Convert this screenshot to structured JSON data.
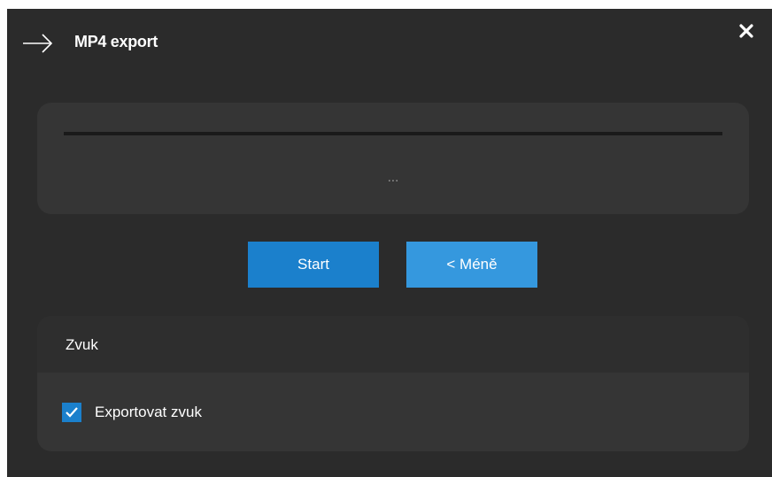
{
  "header": {
    "title": "MP4 export",
    "back_icon": "arrow-right-icon",
    "close_icon": "close-icon"
  },
  "progress": {
    "value": 0,
    "status_text": "..."
  },
  "buttons": {
    "start_label": "Start",
    "less_label": "< Méně"
  },
  "sound": {
    "title": "Zvuk",
    "export_audio_label": "Exportovat zvuk",
    "export_audio_checked": true
  },
  "colors": {
    "background": "#2b2b2b",
    "panel": "#353535",
    "accent": "#1b80cc",
    "accent_light": "#3598de",
    "text": "#ffffff",
    "muted_text": "#9a9a9a"
  }
}
